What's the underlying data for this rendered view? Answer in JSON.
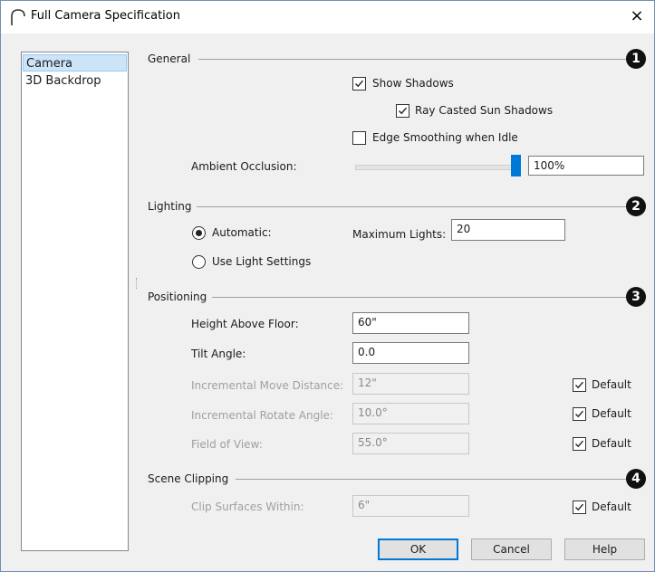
{
  "window": {
    "title": "Full Camera Specification",
    "close_glyph": "×"
  },
  "nav": {
    "items": [
      {
        "label": "Camera",
        "selected": true
      },
      {
        "label": "3D Backdrop",
        "selected": false
      }
    ]
  },
  "general": {
    "heading": "General",
    "badge": "1",
    "show_shadows": {
      "label": "Show Shadows",
      "checked": true
    },
    "ray_casted": {
      "label": "Ray Casted Sun Shadows",
      "checked": true
    },
    "edge_smoothing": {
      "label": "Edge Smoothing when Idle",
      "checked": false
    },
    "ambient_label": "Ambient Occlusion:",
    "ambient_value": "100%",
    "ambient_level": 1.0
  },
  "lighting": {
    "heading": "Lighting",
    "badge": "2",
    "automatic_label": "Automatic:",
    "use_light_label": "Use Light Settings",
    "selected": "automatic",
    "max_lights_label": "Maximum Lights:",
    "max_lights_value": "20"
  },
  "positioning": {
    "heading": "Positioning",
    "badge": "3",
    "height_label": "Height Above Floor:",
    "height_value": "60\"",
    "tilt_label": "Tilt Angle:",
    "tilt_value": "0.0",
    "move_label": "Incremental Move Distance:",
    "move_value": "12\"",
    "rotate_label": "Incremental Rotate Angle:",
    "rotate_value": "10.0°",
    "fov_label": "Field of View:",
    "fov_value": "55.0°",
    "default_label": "Default"
  },
  "scene_clipping": {
    "heading": "Scene Clipping",
    "badge": "4",
    "clip_label": "Clip Surfaces Within:",
    "clip_value": "6\"",
    "default_label": "Default"
  },
  "buttons": {
    "ok": "OK",
    "cancel": "Cancel",
    "help": "Help"
  },
  "colors": {
    "accent": "#0078d7",
    "selection": "#cce4f7",
    "disabled_text": "#a0a0a0"
  }
}
